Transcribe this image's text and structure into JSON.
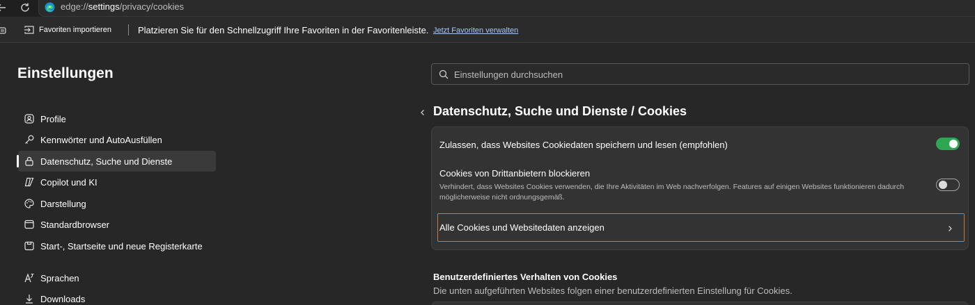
{
  "browser": {
    "url_prefix": "edge://",
    "url_host": "settings",
    "url_path": "/privacy/cookies"
  },
  "favorites_bar": {
    "import_label": "Favoriten importieren",
    "message": "Platzieren Sie für den Schnellzugriff Ihre Favoriten in der Favoritenleiste.",
    "manage_link": "Jetzt Favoriten verwalten"
  },
  "sidebar": {
    "title": "Einstellungen",
    "items": [
      {
        "label": "Profile",
        "icon": "profile-icon",
        "active": false
      },
      {
        "label": "Kennwörter und AutoAusfüllen",
        "icon": "key-icon",
        "active": false
      },
      {
        "label": "Datenschutz, Suche und Dienste",
        "icon": "lock-icon",
        "active": true
      },
      {
        "label": "Copilot und KI",
        "icon": "copilot-icon",
        "active": false
      },
      {
        "label": "Darstellung",
        "icon": "palette-icon",
        "active": false
      },
      {
        "label": "Standardbrowser",
        "icon": "browser-icon",
        "active": false
      },
      {
        "label": "Start-, Startseite und neue Registerkarte",
        "icon": "home-page-icon",
        "active": false
      },
      {
        "label": "Sprachen",
        "icon": "language-icon",
        "active": false
      },
      {
        "label": "Downloads",
        "icon": "download-icon",
        "active": false
      }
    ]
  },
  "search": {
    "placeholder": "Einstellungen durchsuchen",
    "value": ""
  },
  "page": {
    "title": "Datenschutz, Suche und Dienste  /  Cookies"
  },
  "cookies_card": {
    "allow_label": "Zulassen, dass Websites Cookiedaten speichern und lesen (empfohlen)",
    "allow_enabled": true,
    "third_party_label": "Cookies von Drittanbietern blockieren",
    "third_party_desc": "Verhindert, dass Websites Cookies verwenden, die Ihre Aktivitäten im Web nachverfolgen. Features auf einigen Websites funktionieren dadurch möglicherweise nicht ordnungsgemäß.",
    "third_party_enabled": false,
    "all_cookies_label": "Alle Cookies und Websitedaten anzeigen"
  },
  "custom_section": {
    "title": "Benutzerdefiniertes Verhalten von Cookies",
    "desc": "Die unten aufgeführten Websites folgen einer benutzerdefinierten Einstellung für Cookies."
  },
  "colors": {
    "background": "#272727",
    "card": "#333333",
    "toggle_on": "#2fa653",
    "focus_outline": "#c97a3d",
    "link": "#a6c8ff"
  }
}
